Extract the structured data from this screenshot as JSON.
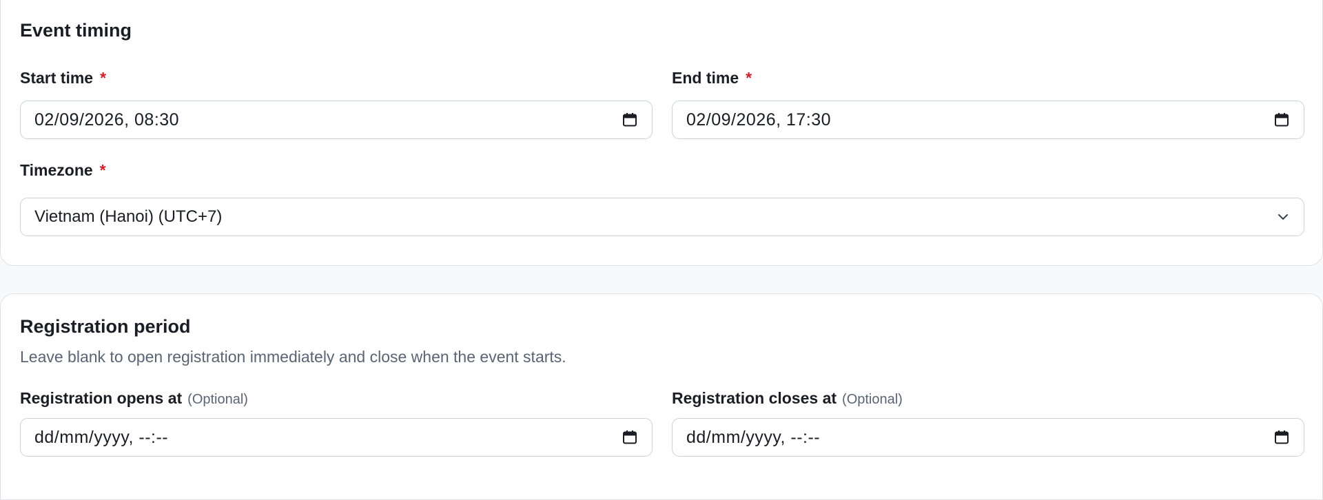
{
  "event_timing": {
    "title": "Event timing",
    "start_time": {
      "label": "Start time",
      "required_mark": "*",
      "value": "02/09/2026, 08:30",
      "icon": "calendar-icon"
    },
    "end_time": {
      "label": "End time",
      "required_mark": "*",
      "value": "02/09/2026, 17:30",
      "icon": "calendar-icon"
    },
    "timezone": {
      "label": "Timezone",
      "required_mark": "*",
      "selected": "Vietnam (Hanoi) (UTC+7)",
      "icon": "chevron-down-icon"
    }
  },
  "registration_period": {
    "title": "Registration period",
    "description": "Leave blank to open registration immediately and close when the event starts.",
    "opens_at": {
      "label": "Registration opens at",
      "optional_text": "(Optional)",
      "placeholder": "dd/mm/yyyy, --:--",
      "icon": "calendar-icon"
    },
    "closes_at": {
      "label": "Registration closes at",
      "optional_text": "(Optional)",
      "placeholder": "dd/mm/yyyy, --:--",
      "icon": "calendar-icon"
    }
  },
  "colors": {
    "required": "#d0202a",
    "muted_text": "#5a6472",
    "border": "#cdd1d9",
    "page_bg": "#f8f9fb"
  }
}
